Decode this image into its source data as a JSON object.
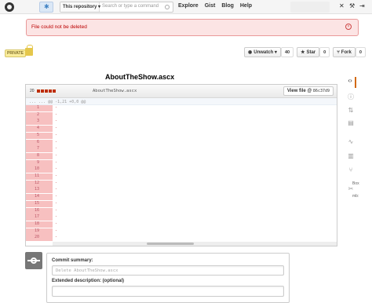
{
  "header": {
    "search_scope": "This repository ▾",
    "search_placeholder": "Search or type a command",
    "nav": [
      "Explore",
      "Gist",
      "Blog",
      "Help"
    ]
  },
  "flash": {
    "message": "File could not be deleted"
  },
  "repo": {
    "private_label": "PRIVATE",
    "watch_label": "Unwatch ▾",
    "watch_count": "40",
    "star_label": "Star",
    "star_count": "0",
    "fork_label": "Fork",
    "fork_count": "0"
  },
  "file": {
    "title": "AboutTheShow.ascx",
    "diff_stat": "20",
    "diff_filename": "AboutTheShow.ascx",
    "view_file_label": "View file @",
    "sha": "86c37d9",
    "hunk_header": "... ...   @@ -1,21 +0,0 @@",
    "line_numbers": [
      "1",
      "2",
      "3",
      "4",
      "5",
      "6",
      "7",
      "8",
      "9",
      "10",
      "11",
      "12",
      "13",
      "14",
      "15",
      "16",
      "17",
      "18",
      "19",
      "20"
    ]
  },
  "side_text": {
    "a": "Box",
    "b": "mb:"
  },
  "commit": {
    "summary_label": "Commit summary:",
    "summary_placeholder": "Delete AboutTheShow.ascx",
    "description_label": "Extended description: (optional)"
  },
  "colors": {
    "flash_bg": "#fce4e4",
    "deleted_gutter": "#f7c0c0",
    "accent": "#d26911"
  }
}
